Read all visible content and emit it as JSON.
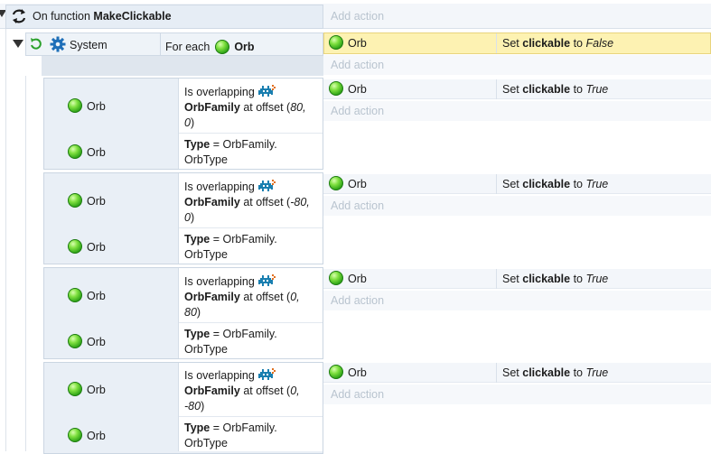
{
  "function_event": {
    "prefix": "On function",
    "name": "MakeClickable",
    "add_action_label": "Add action"
  },
  "system_event": {
    "object_name": "System",
    "condition_prefix": "For each",
    "condition_object": "Orb",
    "action_object": "Orb",
    "action_prefix": "Set",
    "action_property": "clickable",
    "action_to": "to",
    "action_value": "False",
    "add_action_label": "Add action"
  },
  "sub_events": [
    {
      "object_1": "Orb",
      "object_2": "Orb",
      "overlap_prefix": "Is overlapping",
      "overlap_family": "OrbFamily",
      "offset_prefix": "at offset (",
      "offset_line1": "80,",
      "offset_line2": "0",
      "offset_suffix": ")",
      "type_label": "Type",
      "type_eq": " = OrbFamily.",
      "type_line2": "OrbType",
      "action_object": "Orb",
      "action_prefix": "Set",
      "action_property": "clickable",
      "action_to": "to",
      "action_value": "True",
      "add_action_label": "Add action"
    },
    {
      "object_1": "Orb",
      "object_2": "Orb",
      "overlap_prefix": "Is overlapping",
      "overlap_family": "OrbFamily",
      "offset_prefix": "at offset (",
      "offset_line1": "-80,",
      "offset_line2": "0",
      "offset_suffix": ")",
      "type_label": "Type",
      "type_eq": " = OrbFamily.",
      "type_line2": "OrbType",
      "action_object": "Orb",
      "action_prefix": "Set",
      "action_property": "clickable",
      "action_to": "to",
      "action_value": "True",
      "add_action_label": "Add action"
    },
    {
      "object_1": "Orb",
      "object_2": "Orb",
      "overlap_prefix": "Is overlapping",
      "overlap_family": "OrbFamily",
      "offset_prefix": "at offset (",
      "offset_line1": "0,",
      "offset_line2": "80",
      "offset_suffix": ")",
      "type_label": "Type",
      "type_eq": " = OrbFamily.",
      "type_line2": "OrbType",
      "action_object": "Orb",
      "action_prefix": "Set",
      "action_property": "clickable",
      "action_to": "to",
      "action_value": "True",
      "add_action_label": "Add action"
    },
    {
      "object_1": "Orb",
      "object_2": "Orb",
      "overlap_prefix": "Is overlapping",
      "overlap_family": "OrbFamily",
      "offset_prefix": "at offset (",
      "offset_line1": "0,",
      "offset_line2": "-80",
      "offset_suffix": ")",
      "type_label": "Type",
      "type_eq": " = OrbFamily.",
      "type_line2": "OrbType",
      "action_object": "Orb",
      "action_prefix": "Set",
      "action_property": "clickable",
      "action_to": "to",
      "action_value": "True",
      "add_action_label": "Add action"
    }
  ],
  "icons": {
    "function": "function-loop-icon",
    "collapse": "collapse-arrow-icon",
    "loop": "loop-icon",
    "system": "gear-icon",
    "orb": "orb-icon",
    "family": "family-sprite-icon"
  },
  "colors": {
    "selected_row": "#fdf2b2",
    "orb_green": "#2ea318",
    "add_action_text": "#b9c4cf",
    "gear_blue": "#1f6fb8"
  }
}
